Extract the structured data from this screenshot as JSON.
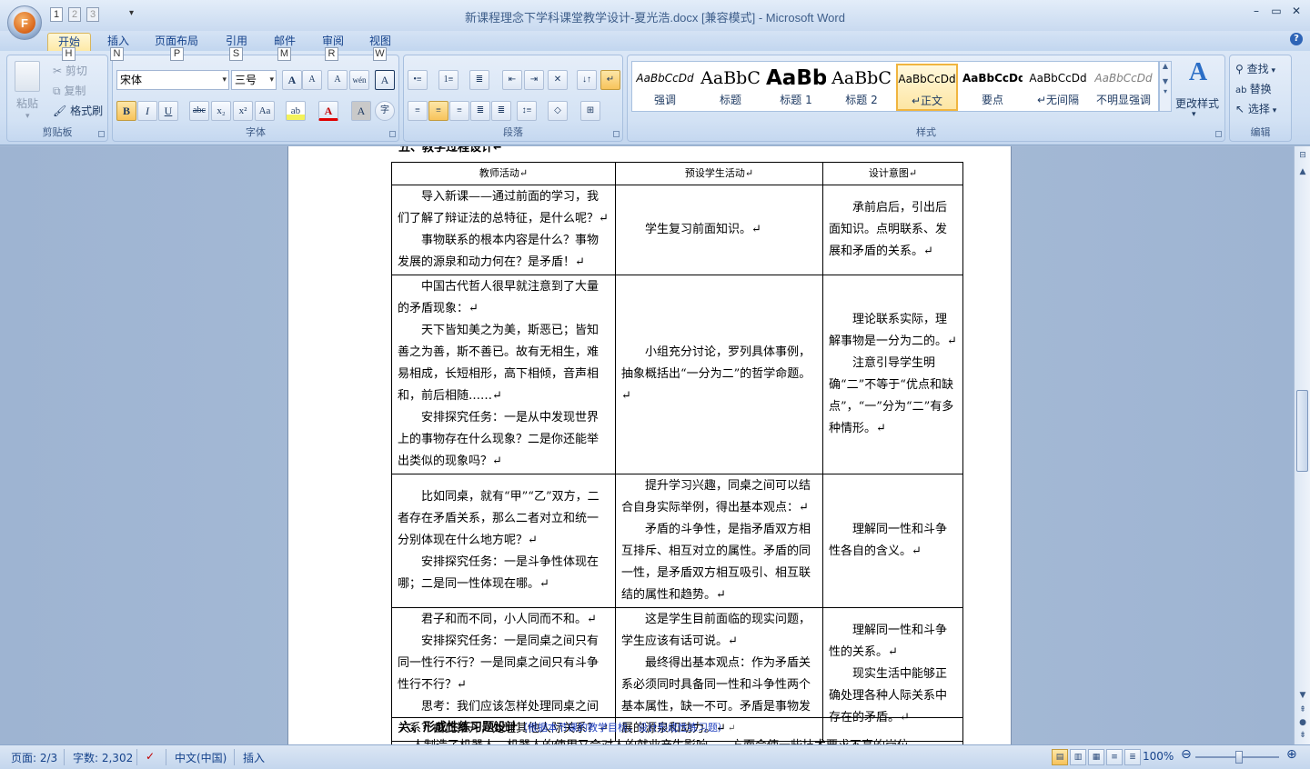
{
  "window": {
    "title": "新课程理念下学科课堂教学设计-夏光浩.docx [兼容模式] - Microsoft Word",
    "office_button_letter": "F",
    "qat_keytips": [
      "1",
      "2",
      "3"
    ],
    "help": "?"
  },
  "tabs": [
    {
      "label": "开始",
      "keytip": "H",
      "active": true
    },
    {
      "label": "插入",
      "keytip": "N"
    },
    {
      "label": "页面布局",
      "keytip": "P"
    },
    {
      "label": "引用",
      "keytip": "S"
    },
    {
      "label": "邮件",
      "keytip": "M"
    },
    {
      "label": "审阅",
      "keytip": "R"
    },
    {
      "label": "视图",
      "keytip": "W"
    }
  ],
  "ribbon": {
    "clipboard": {
      "label": "剪贴板",
      "paste": "粘贴",
      "cut": "剪切",
      "copy": "复制",
      "format_painter": "格式刷"
    },
    "font": {
      "label": "字体",
      "font_name": "宋体",
      "font_size": "三号",
      "grow": "A",
      "shrink": "A",
      "clear": "A",
      "phonetic": "wén",
      "border_char": "A",
      "bold": "B",
      "italic": "I",
      "underline": "U",
      "strike": "abc",
      "sub": "x₂",
      "sup": "x²",
      "case": "Aa",
      "highlight": "ab",
      "color": "A",
      "shade": "A",
      "enclose": "字"
    },
    "paragraph": {
      "label": "段落"
    },
    "styles": {
      "label": "样式",
      "items": [
        {
          "preview": "AaBbCcDd",
          "name": "强调"
        },
        {
          "preview": "AaBbC",
          "name": "标题"
        },
        {
          "preview": "AaBb",
          "name": "标题 1"
        },
        {
          "preview": "AaBbC",
          "name": "标题 2"
        },
        {
          "preview": "AaBbCcDd",
          "name": "↵正文",
          "selected": true
        },
        {
          "preview": "AaBbCcDd",
          "name": "要点"
        },
        {
          "preview": "AaBbCcDd",
          "name": "↵无间隔"
        },
        {
          "preview": "AaBbCcDd",
          "name": "不明显强调"
        }
      ],
      "change_styles": "更改样式"
    },
    "editing": {
      "label": "编辑",
      "find": "查找",
      "replace": "替换",
      "select": "选择"
    }
  },
  "document": {
    "section5_heading_clipped": "五、教学过程设计↵",
    "table_headers": [
      "教师活动↵",
      "预设学生活动↵",
      "设计意图↵"
    ],
    "rows": [
      {
        "teacher": [
          "导入新课——通过前面的学习，我们了解了辩证法的总特征，是什么呢？↵",
          "事物联系的根本内容是什么？事物发展的源泉和动力何在？是矛盾！↵"
        ],
        "student": [
          "学生复习前面知识。↵"
        ],
        "intent": [
          "承前启后，引出后面知识。点明联系、发展和矛盾的关系。↵"
        ]
      },
      {
        "teacher": [
          "中国古代哲人很早就注意到了大量的矛盾现象：↵",
          "天下皆知美之为美，斯恶已；皆知善之为善，斯不善已。故有无相生，难易相成，长短相形，高下相倾，音声相和，前后相随……↵",
          "安排探究任务：一是从中发现世界上的事物存在什么现象？二是你还能举出类似的现象吗？↵"
        ],
        "student": [
          "小组充分讨论，罗列具体事例，抽象概括出“一分为二”的哲学命题。↵"
        ],
        "intent": [
          "理论联系实际，理解事物是一分为二的。↵",
          "注意引导学生明确“二”不等于“优点和缺点”，“一”分为“二”有多种情形。↵"
        ]
      },
      {
        "teacher": [
          "比如同桌，就有“甲”“乙”双方，二者存在矛盾关系，那么二者对立和统一分别体现在什么地方呢？↵",
          "安排探究任务：一是斗争性体现在哪；二是同一性体现在哪。↵"
        ],
        "student": [
          "提升学习兴趣，同桌之间可以结合自身实际举例，得出基本观点：↵",
          "矛盾的斗争性，是指矛盾双方相互排斥、相互对立的属性。矛盾的同一性，是矛盾双方相互吸引、相互联结的属性和趋势。↵"
        ],
        "intent": [
          "理解同一性和斗争性各自的含义。↵"
        ]
      },
      {
        "teacher": [
          "君子和而不同，小人同而不和。↵",
          "安排探究任务：一是同桌之间只有同一性行不行？一是同桌之间只有斗争性行不行？↵",
          "思考：我们应该怎样处理同桌之间关系？由此推开，处理其他人际关系？↵"
        ],
        "student": [
          "这是学生目前面临的现实问题，学生应该有话可说。↵",
          "最终得出基本观点：作为矛盾关系必须同时具备同一性和斗争性两个基本属性，缺一不可。矛盾是事物发展的源泉和动力。↵"
        ],
        "intent": [
          "理解同一性和斗争性的关系。↵",
          "现实生活中能够正确处理各种人际关系中存在的矛盾。↵"
        ]
      }
    ],
    "section6": {
      "title": "六、形成性练习题设计",
      "note": "（根据本节课的教学目标，设计形成性练习题）",
      "end": "↵"
    },
    "next_line_clipped": "人制造了机器人，机器人的使用又会对人的就业产生影响……方面会使一些技术要求不高的岗位"
  },
  "status": {
    "page": "页面: 2/3",
    "words": "字数: 2,302",
    "language": "中文(中国)",
    "mode": "插入",
    "zoom": "100%"
  }
}
